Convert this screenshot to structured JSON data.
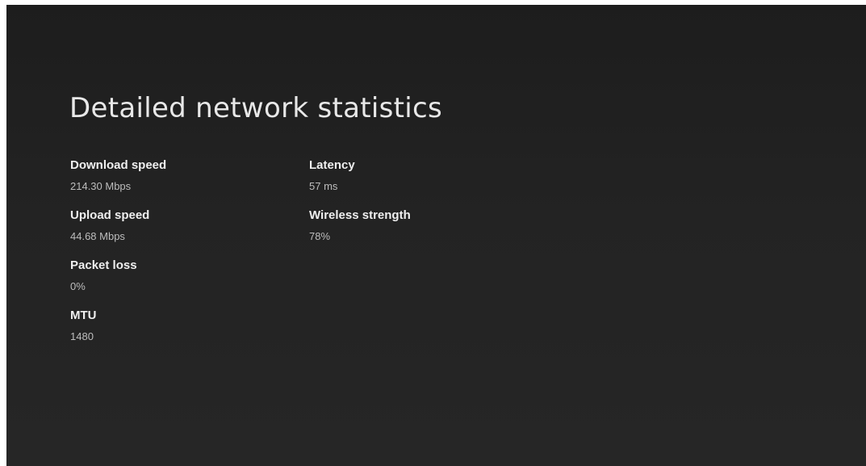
{
  "page": {
    "title": "Detailed network statistics"
  },
  "stats": {
    "download_speed": {
      "label": "Download speed",
      "value": "214.30 Mbps"
    },
    "upload_speed": {
      "label": "Upload speed",
      "value": "44.68 Mbps"
    },
    "packet_loss": {
      "label": "Packet loss",
      "value": "0%"
    },
    "mtu": {
      "label": "MTU",
      "value": "1480"
    },
    "latency": {
      "label": "Latency",
      "value": "57 ms"
    },
    "wireless_strength": {
      "label": "Wireless strength",
      "value": "78%"
    }
  },
  "colors": {
    "background": "#222222",
    "label_text": "#efefef",
    "value_text": "#bdbdbd"
  }
}
